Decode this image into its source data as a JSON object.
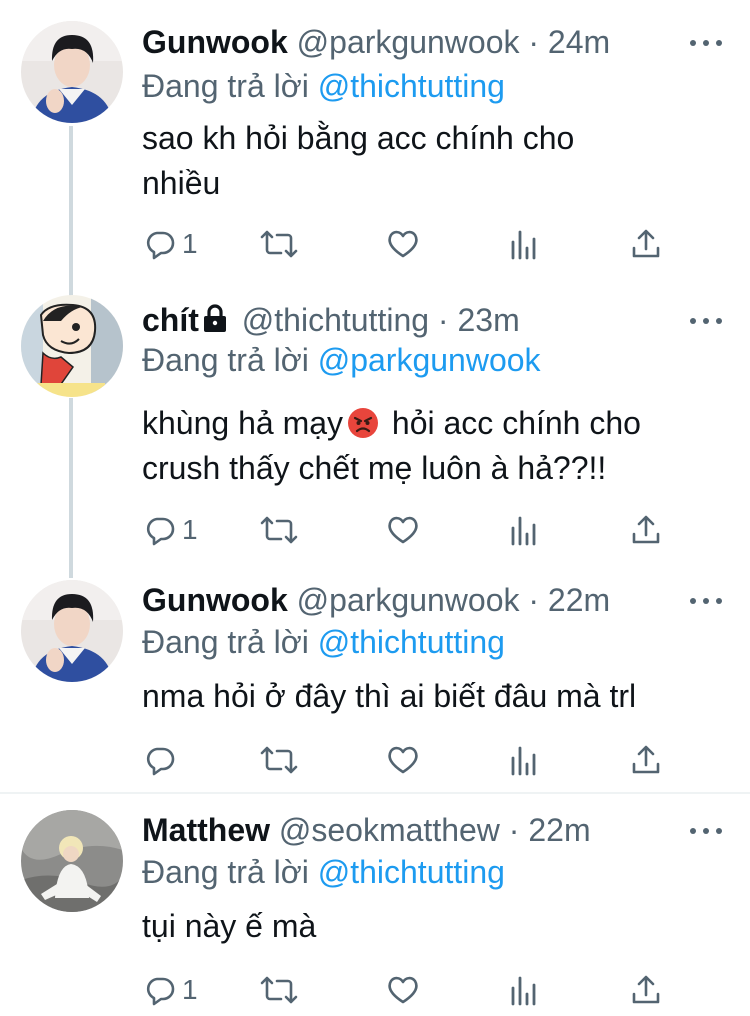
{
  "replying_prefix": "Đang trả lời",
  "tweets": [
    {
      "name": "Gunwook",
      "handle": "@parkgunwook",
      "separator": "·",
      "time": "24m",
      "reply_to": "@thichtutting",
      "text_lines": [
        "sao kh hỏi bằng acc chính cho",
        "nhiều"
      ],
      "reply_count": "1"
    },
    {
      "name": "chít",
      "handle": "@thichtutting",
      "separator": "·",
      "time": "23m",
      "reply_to": "@parkgunwook",
      "text_line1_before_emoji": "khùng hả mạy",
      "text_line1_after_emoji": "hỏi acc chính cho",
      "text_line2": "crush thấy chết mẹ luôn à hả??!!",
      "emoji": "angry-face-emoji",
      "protected_icon": "lock-icon",
      "reply_count": "1"
    },
    {
      "name": "Gunwook",
      "handle": "@parkgunwook",
      "separator": "·",
      "time": "22m",
      "reply_to": "@thichtutting",
      "text_lines": [
        "nma hỏi ở đây thì ai biết đâu mà trl"
      ],
      "reply_count": ""
    },
    {
      "name": "Matthew",
      "handle": "@seokmatthew",
      "separator": "·",
      "time": "22m",
      "reply_to": "@thichtutting",
      "text_lines": [
        "tụi này ế mà"
      ],
      "reply_count": "1"
    }
  ],
  "icons": {
    "reply": "reply-icon",
    "retweet": "retweet-icon",
    "like": "heart-icon",
    "views": "views-icon",
    "share": "share-icon",
    "more": "more-icon"
  },
  "colors": {
    "text": "#0f1419",
    "secondary": "#536471",
    "link": "#1d9bf0",
    "thread_line": "#cfd9de",
    "divider": "#eff3f4"
  }
}
